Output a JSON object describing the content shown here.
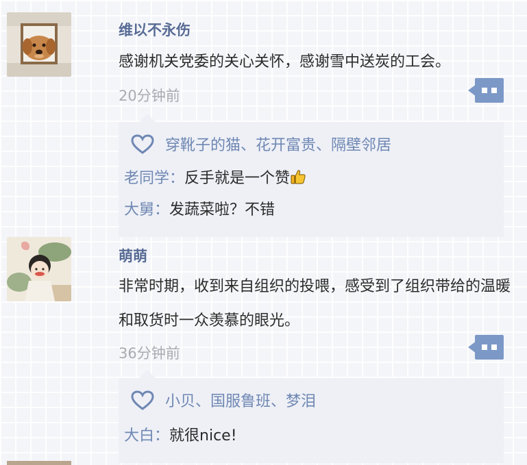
{
  "posts": [
    {
      "username": "维以不永伤",
      "content": "感谢机关党委的关心关怀，感谢雪中送炭的工会。",
      "time": "20分钟前",
      "likes": "穿靴子的猫、花开富贵、隔壁邻居",
      "comments": [
        {
          "author": "老同学",
          "sep": "：",
          "text": "反手就是一个赞",
          "emoji": "thumbs-up-icon"
        },
        {
          "author": "大舅",
          "sep": "：",
          "text": "发蔬菜啦？不错"
        }
      ]
    },
    {
      "username": "萌萌",
      "content": "非常时期，收到来自组织的投喂，感受到了组织带给的温暖和取货时一众羡慕的眼光。",
      "time": "36分钟前",
      "likes": "小贝、国服鲁班、梦泪",
      "comments": [
        {
          "author": "大白",
          "sep": "：",
          "text": "就很nice!"
        }
      ]
    }
  ],
  "colors": {
    "username": "#576b95",
    "link": "#6f87b3",
    "time": "#a9abb0",
    "accent": "#7b98c7",
    "panel": "#eef0f6"
  },
  "icons": [
    "heart-icon",
    "more-comment-icon",
    "thumbs-up-icon"
  ]
}
